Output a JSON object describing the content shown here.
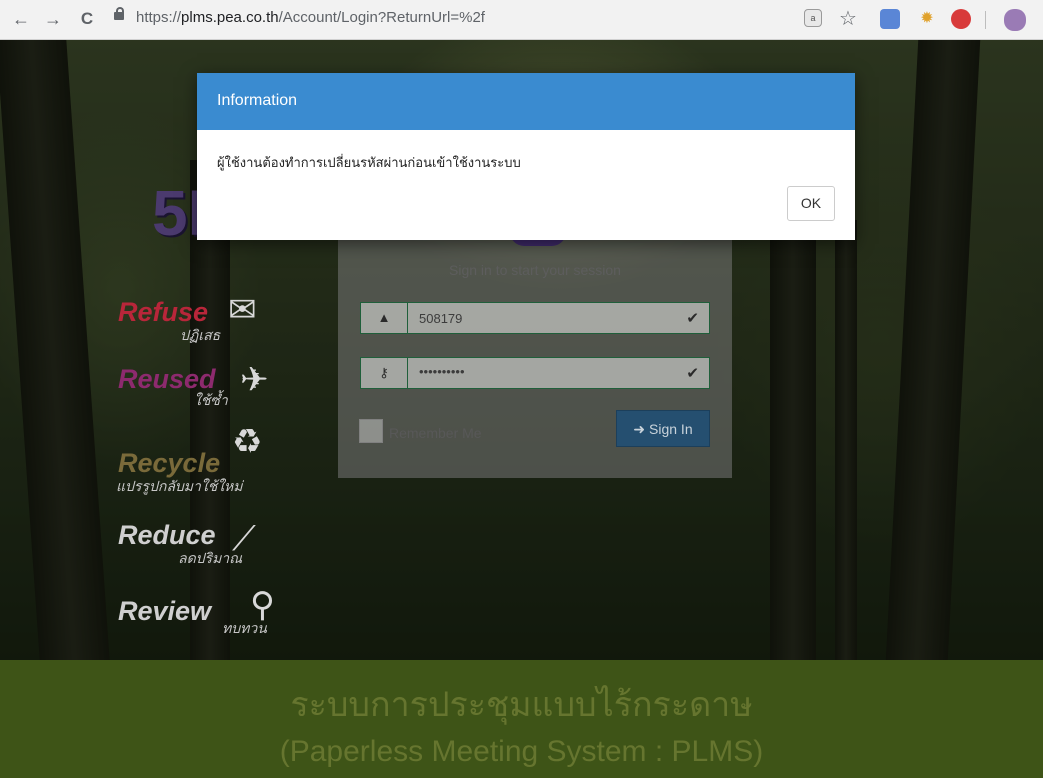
{
  "browser": {
    "back_icon": "←",
    "forward_icon": "→",
    "reload_icon": "C",
    "url_scheme": "https://",
    "url_host": "plms.pea.co.th",
    "url_path": "/Account/Login?ReturnUrl=%2f",
    "star_icon": "☆"
  },
  "left_panel": {
    "logo": "5R",
    "items": [
      {
        "word": "Refuse",
        "sub": "ปฏิเสธ",
        "color": "#b8263a"
      },
      {
        "word": "Reused",
        "sub": "ใช้ซ้ำ",
        "color": "#8d2a6e"
      },
      {
        "word": "Recycle",
        "sub": "แปรรูปกลับมาใช้ใหม่",
        "color": "#7a6a3a"
      },
      {
        "word": "Reduce",
        "sub": "ลดปริมาณ",
        "color": "#cfcfcf"
      },
      {
        "word": "Review",
        "sub": "ทบทวน",
        "color": "#cfcfcf"
      }
    ]
  },
  "login": {
    "title": "Sign in to start your session",
    "username_value": "508179",
    "password_value": "••••••••••",
    "remember_label": "Remember Me",
    "signin_label": "Sign In"
  },
  "footer": {
    "thai_title": "ระบบการประชุมแบบไร้กระดาษ",
    "english_title": "(Paperless Meeting System : PLMS)"
  },
  "modal": {
    "title": "Information",
    "message": "ผู้ใช้งานต้องทำการเปลี่ยนรหัสผ่านก่อนเข้าใช้งานระบบ",
    "ok_label": "OK"
  }
}
